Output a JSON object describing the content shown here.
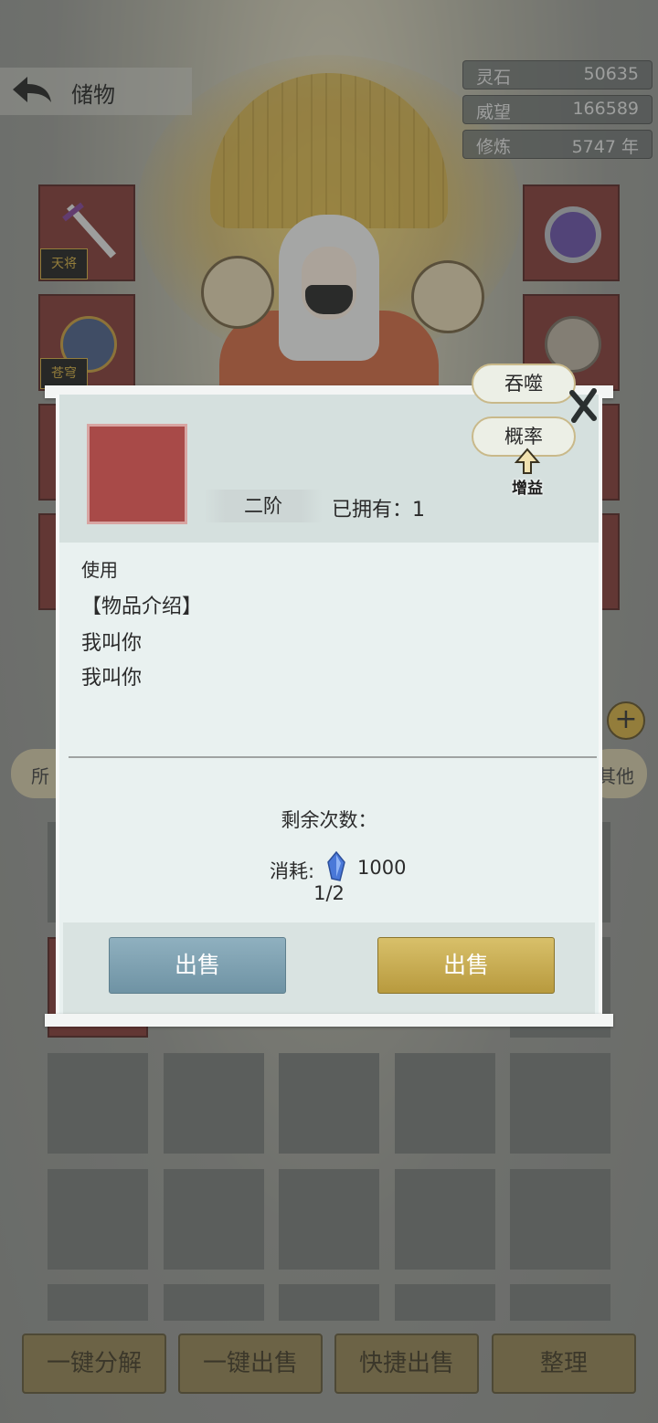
{
  "header": {
    "title": "储物",
    "stats": [
      {
        "key": "灵石",
        "value": "50635"
      },
      {
        "key": "威望",
        "value": "166589"
      },
      {
        "key": "修炼",
        "value": "5747 年"
      }
    ]
  },
  "equipment": {
    "left_badges": [
      "天将",
      "苍穹"
    ],
    "right_slots": 4
  },
  "filter": {
    "left_tab": "所",
    "right_tab": "其他"
  },
  "bottom_bar": {
    "decompose": "一键分解",
    "sell_all": "一键出售",
    "quick_sell": "快捷出售",
    "sort": "整理"
  },
  "dialog": {
    "tier": "二阶",
    "owned": "已拥有：1",
    "use_label": "使用",
    "desc_lines": [
      "【物品介绍】",
      "我叫你",
      "我叫你"
    ],
    "remaining_label": "剩余次数：",
    "cost_label": "消耗:",
    "cost_amount": "1000",
    "count": "1/2",
    "sell_left": "出售",
    "sell_right": "出售",
    "devour": "吞噬",
    "rate": "概率",
    "boost": "增益",
    "colors": {
      "item_placeholder": "#a84a48",
      "button_blue": "#7a9fb0",
      "button_gold": "#c9a94e"
    }
  }
}
